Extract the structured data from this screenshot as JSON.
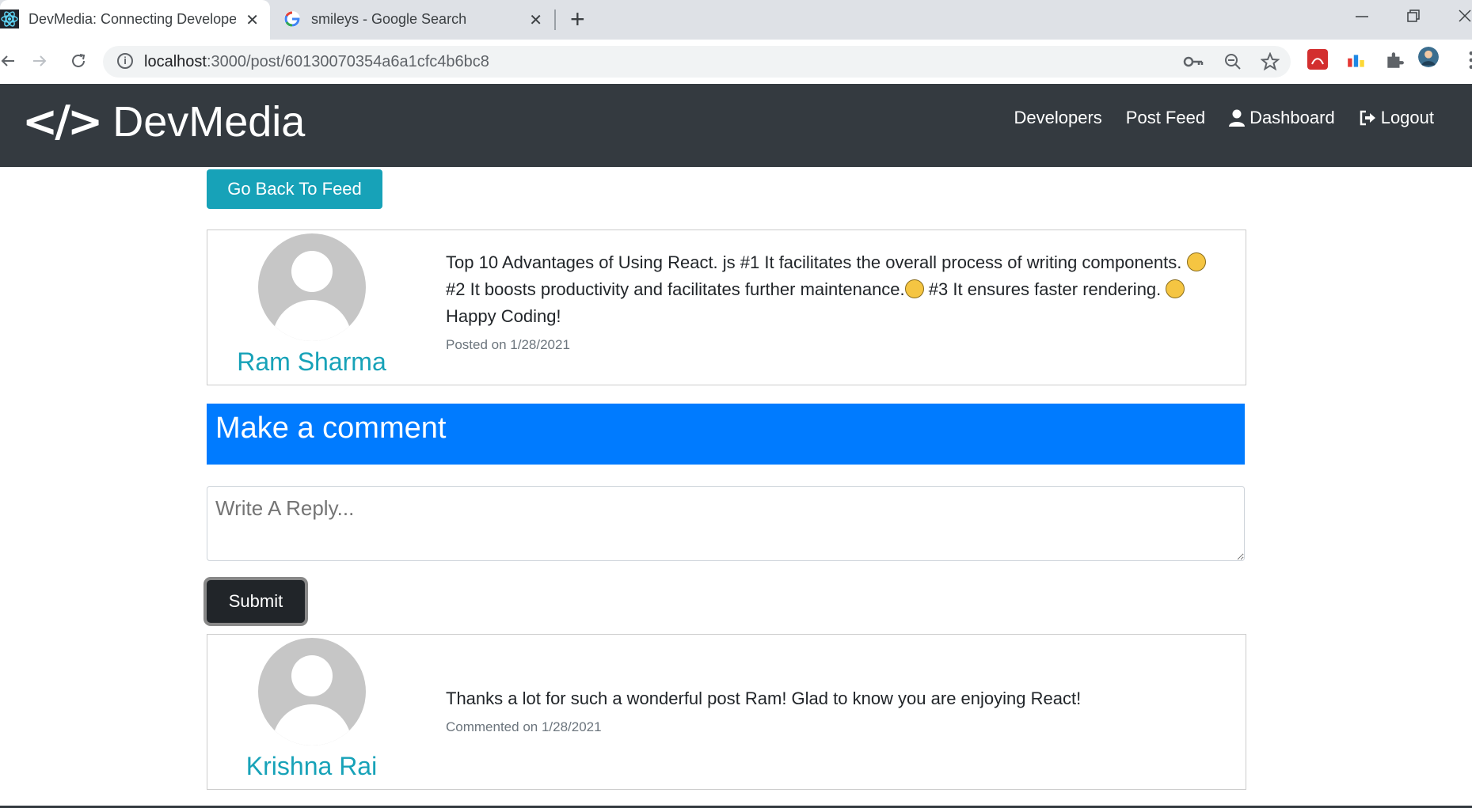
{
  "browser": {
    "tabs": [
      {
        "title": "DevMedia: Connecting Develope",
        "close": "✕",
        "active": true
      },
      {
        "title": "smileys - Google Search",
        "close": "✕",
        "active": false
      }
    ],
    "new_tab": "+",
    "url_host": "localhost",
    "url_rest": ":3000/post/60130070354a6a1cfc4b6bc8"
  },
  "navbar": {
    "brand_icon": "</>",
    "brand": "DevMedia",
    "links": [
      "Developers",
      "Post Feed",
      "Dashboard",
      "Logout"
    ]
  },
  "actions": {
    "back_label": "Go Back To Feed",
    "submit_label": "Submit"
  },
  "post": {
    "author": "Ram Sharma",
    "text_1": "Top 10 Advantages of Using React. js #1 It facilitates the overall process of writing components.",
    "text_2": "#2 It boosts productivity and facilitates further maintenance.",
    "text_3": "#3 It ensures faster rendering.",
    "text_4": "Happy Coding!",
    "date": "Posted on 1/28/2021"
  },
  "comment_form": {
    "header": "Make a comment",
    "placeholder": "Write A Reply..."
  },
  "comments": [
    {
      "author": "Krishna Rai",
      "text": "Thanks a lot for such a wonderful post Ram! Glad to know you are enjoying React!",
      "date": "Commented on 1/28/2021"
    }
  ],
  "colors": {
    "navbar": "#343a40",
    "accent": "#17a2b8",
    "primary": "#007bff",
    "dark": "#212529"
  }
}
